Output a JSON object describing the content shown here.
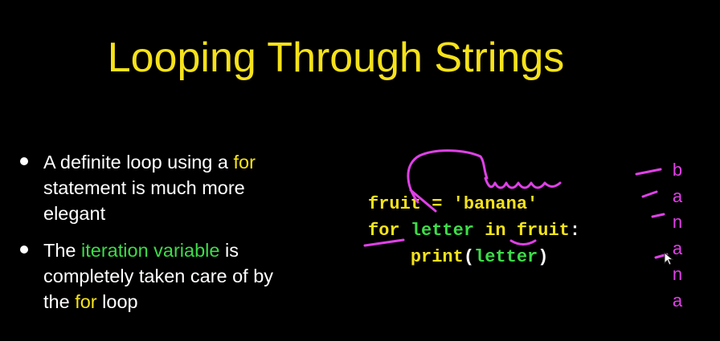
{
  "slide": {
    "title": "Looping Through Strings",
    "bullets": [
      {
        "parts": [
          {
            "text": "A definite loop using a ",
            "style": "plain"
          },
          {
            "text": "for",
            "style": "yellow"
          },
          {
            "text": " statement is much more elegant",
            "style": "plain"
          }
        ]
      },
      {
        "parts": [
          {
            "text": "The ",
            "style": "plain"
          },
          {
            "text": "iteration variable",
            "style": "green"
          },
          {
            "text": " is completely taken care of by the ",
            "style": "plain"
          },
          {
            "text": "for",
            "style": "yellow"
          },
          {
            "text": " loop",
            "style": "plain"
          }
        ]
      }
    ],
    "code": {
      "line1": {
        "var": "fruit",
        "op": " = ",
        "str": "'banana'"
      },
      "line2": {
        "kw_for": "for",
        "var": "letter",
        "kw_in": "in",
        "iter": "fruit",
        "colon": ":"
      },
      "line3": {
        "indent": "    ",
        "func": "print",
        "open": "(",
        "arg": "letter",
        "close": ")"
      }
    },
    "output_letters": [
      "b",
      "a",
      "n",
      "a",
      "n",
      "a"
    ]
  },
  "colors": {
    "background": "#000000",
    "title": "#f5e21a",
    "keyword_yellow": "#f5e21a",
    "keyword_green": "#3ddc48",
    "annotation_magenta": "#e040e8",
    "text": "#ffffff"
  },
  "icons": {
    "bullet": "bullet-dot-icon",
    "cursor": "mouse-pointer-icon"
  }
}
